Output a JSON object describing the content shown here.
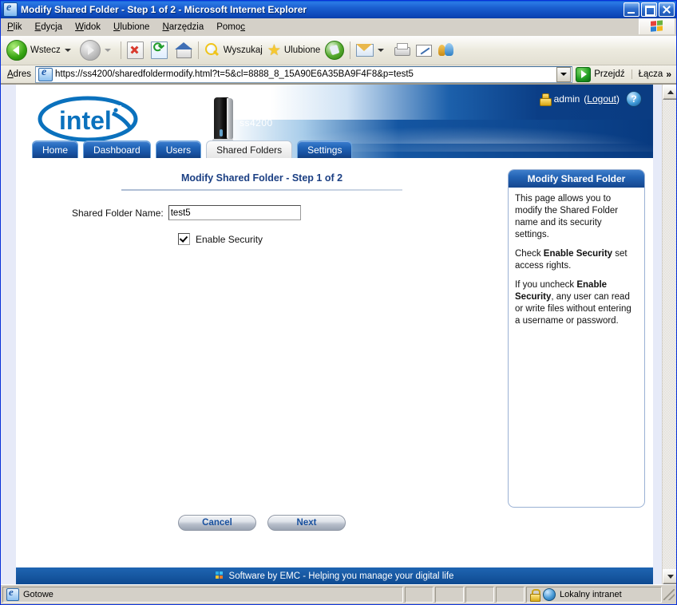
{
  "window": {
    "title": "Modify Shared Folder - Step 1 of 2 - Microsoft Internet Explorer",
    "icon": "ie-document-icon",
    "minimize": "_",
    "maximize": "□",
    "close": "×"
  },
  "menu": {
    "items": [
      {
        "label": "Plik",
        "accel": "P"
      },
      {
        "label": "Edycja",
        "accel": "E"
      },
      {
        "label": "Widok",
        "accel": "W"
      },
      {
        "label": "Ulubione",
        "accel": "U"
      },
      {
        "label": "Narzędzia",
        "accel": "N"
      },
      {
        "label": "Pomoc",
        "accel": "c"
      }
    ]
  },
  "toolbar": {
    "back_label": "Wstecz",
    "forward_label": "",
    "search_label": "Wyszukaj",
    "favorites_label": "Ulubione",
    "buttons": [
      "back-button",
      "forward-button",
      "stop-button",
      "refresh-button",
      "home-button",
      "search-button",
      "favorites-button",
      "media-button",
      "mail-button",
      "print-button",
      "edit-button",
      "messenger-button"
    ]
  },
  "address": {
    "label": "Adres",
    "url": "https://ss4200/sharedfoldermodify.html?t=5&cl=8888_8_15A90E6A35BA9F4F8&p=test5",
    "go_label": "Przejdź",
    "links_label": "Łącza",
    "chevron": "»"
  },
  "site": {
    "brand": "intel",
    "device_name": "ss4200",
    "user": "admin",
    "logout_label": "Logout",
    "help_glyph": "?",
    "tabs": [
      {
        "label": "Home",
        "active": false
      },
      {
        "label": "Dashboard",
        "active": false
      },
      {
        "label": "Users",
        "active": false
      },
      {
        "label": "Shared Folders",
        "active": true
      },
      {
        "label": "Settings",
        "active": false
      }
    ],
    "page_title": "Modify Shared Folder - Step 1 of 2",
    "form": {
      "name_label": "Shared Folder Name:",
      "name_value": "test5",
      "security_label": "Enable Security",
      "security_checked": true
    },
    "buttons": {
      "cancel": "Cancel",
      "next": "Next"
    },
    "help": {
      "title": "Modify Shared Folder",
      "paragraph1": "This page allows you to modify the Shared Folder name and its security settings.",
      "p2_pre": "Check ",
      "p2_bold": "Enable Security",
      "p2_post": " set access rights.",
      "p3_pre": "If you uncheck ",
      "p3_bold": "Enable Security",
      "p3_post": ", any user can read or write files without entering a username or password."
    },
    "footer": "Software by EMC - Helping you manage your digital life"
  },
  "statusbar": {
    "status": "Gotowe",
    "zone": "Lokalny intranet",
    "lock": "secure-lock-icon"
  },
  "colors": {
    "title_blue": "#0a56d6",
    "header_dark_blue": "#0a3c82",
    "tab_blue": "#174f9e",
    "accent_text": "#1b3f83",
    "footer_blue": "#14539c",
    "chrome_gray": "#d4d0c8"
  }
}
